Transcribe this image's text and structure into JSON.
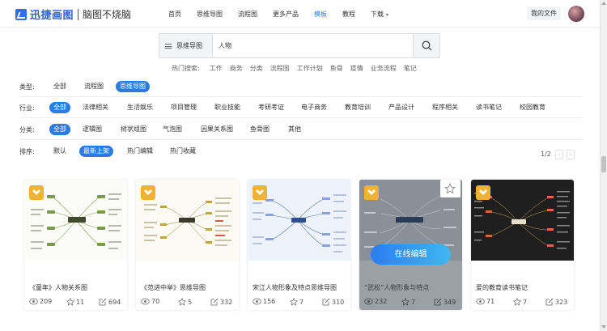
{
  "header": {
    "logo_text": "迅捷画图",
    "slogan": "脑图不烧脑",
    "nav": [
      {
        "label": "首页",
        "active": false
      },
      {
        "label": "思维导图",
        "active": false
      },
      {
        "label": "流程图",
        "active": false
      },
      {
        "label": "更多产品",
        "active": false
      },
      {
        "label": "模板",
        "active": true
      },
      {
        "label": "教程",
        "active": false
      },
      {
        "label": "下载",
        "active": false
      }
    ],
    "my_files": "我的文件"
  },
  "search": {
    "type": "思维导图",
    "value": "人物"
  },
  "hot": {
    "label": "热门搜索:",
    "items": [
      "工作",
      "商务",
      "分类",
      "流程图",
      "工作计划",
      "鱼骨",
      "疫情",
      "业务流程",
      "笔记"
    ]
  },
  "filters": {
    "type": {
      "label": "类型:",
      "options": [
        "全部",
        "流程图",
        "思维导图"
      ],
      "selected": "思维导图"
    },
    "industry": {
      "label": "行业:",
      "options": [
        "全部",
        "法律相关",
        "生活娱乐",
        "项目管理",
        "职业技能",
        "考研考证",
        "电子商务",
        "教育培训",
        "产品设计",
        "程序相关",
        "读书笔记",
        "校园教育"
      ],
      "selected": "全部"
    },
    "category": {
      "label": "分类:",
      "options": [
        "全部",
        "逻辑图",
        "树状组图",
        "气泡图",
        "因果关系图",
        "鱼骨图",
        "其他"
      ],
      "selected": "全部"
    },
    "sort": {
      "label": "排序:",
      "options": [
        "默认",
        "最新上架",
        "热门编辑",
        "热门收藏"
      ],
      "selected": "最新上架"
    }
  },
  "pagination": {
    "text": "1/2"
  },
  "cards": [
    {
      "title": "《童年》人物关系图",
      "views": "209",
      "stars": "11",
      "edits": "694"
    },
    {
      "title": "《范进中举》思维导图",
      "views": "70",
      "stars": "5",
      "edits": "332"
    },
    {
      "title": "宋江人物形象及特点思维导图",
      "views": "156",
      "stars": "7",
      "edits": "310"
    },
    {
      "title": "“武松”人物形象与特点",
      "views": "232",
      "stars": "7",
      "edits": "349",
      "hover_label": "在线编辑"
    },
    {
      "title": "爱的教育读书笔记",
      "views": "71",
      "stars": "7",
      "edits": "323"
    }
  ],
  "colors": {
    "accent": "#2a7be4",
    "badge": "#f2b233"
  }
}
